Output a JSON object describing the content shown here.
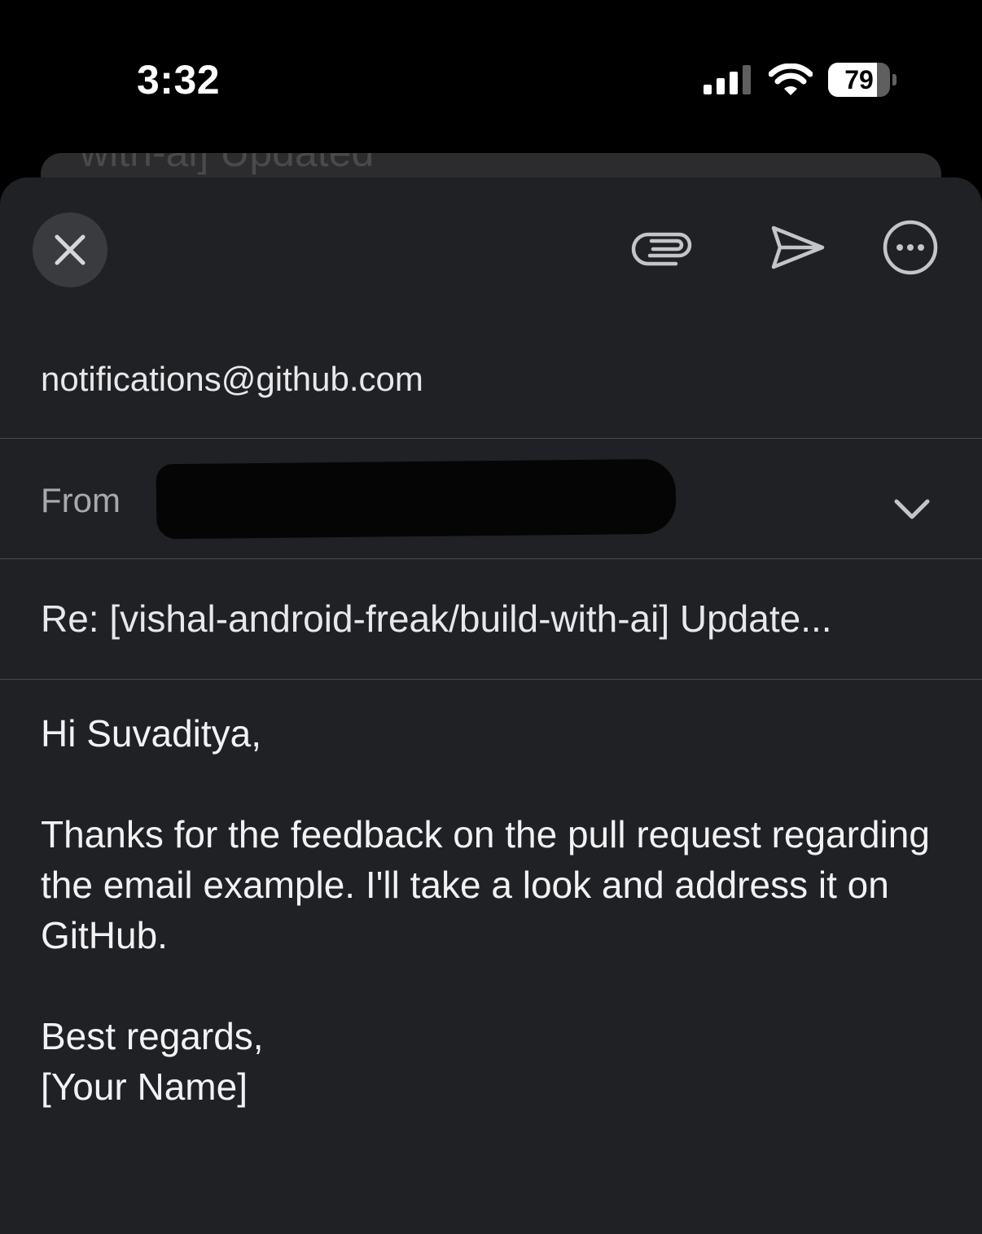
{
  "status_bar": {
    "time": "3:32",
    "battery_level": 79,
    "battery_label": "79",
    "signal_bars_active": 3,
    "signal_bars_total": 4
  },
  "background_sheet": {
    "partial_text": "with-ai] Updated"
  },
  "toolbar": {
    "close_icon": "close-icon",
    "attach_icon": "paperclip-icon",
    "send_icon": "send-icon",
    "more_icon": "more-options-icon"
  },
  "compose": {
    "to": "notifications@github.com",
    "from_label": "From",
    "from_value_redacted": true,
    "subject": "Re: [vishal-android-freak/build-with-ai] Update...",
    "body": "Hi Suvaditya,\n\nThanks for the feedback on the pull request regarding the email example. I'll take a look and address it on GitHub.\n\nBest regards,\n[Your Name]"
  },
  "colors": {
    "sheet_background": "#202124",
    "status_background": "#000000",
    "divider": "#4a4b4e",
    "icon": "#c4c5c9"
  }
}
